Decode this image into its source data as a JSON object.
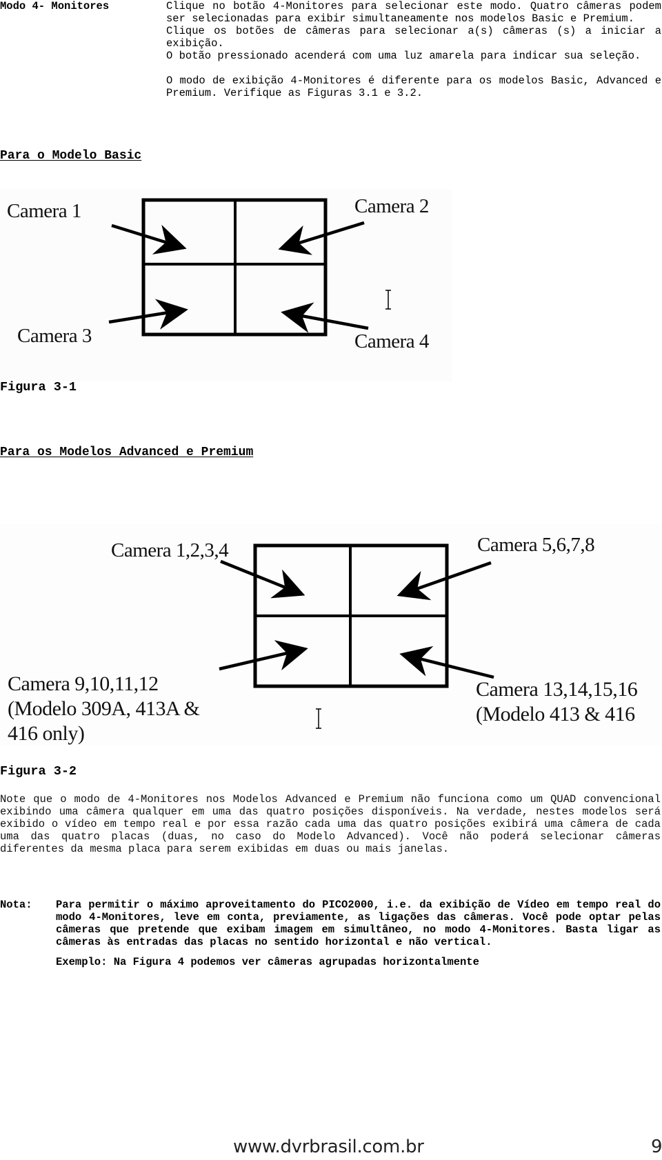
{
  "document": {
    "mode_title": "Modo 4- Monitores",
    "intro_paragraphs": [
      "Clique no botão 4-Monitores para selecionar este modo. Quatro câmeras podem ser selecionadas para exibir simultaneamente nos modelos Basic e Premium.",
      "Clique os botões de câmeras para selecionar a(s) câmeras (s) a iniciar a exibição.",
      "O botão pressionado acenderá com uma luz amarela para indicar sua seleção.",
      "O modo de exibição 4-Monitores é diferente para os modelos Basic, Advanced e Premium. Verifique as Figuras 3.1 e 3.2."
    ],
    "section_basic": {
      "heading": "Para o Modelo Basic",
      "figure_label": "Figura 3-1",
      "cameras": {
        "top_left": "Camera 1",
        "top_right": "Camera 2",
        "bottom_left": "Camera 3",
        "bottom_right": "Camera 4"
      }
    },
    "section_advanced": {
      "heading": "Para os Modelos Advanced e Premium",
      "figure_label": "Figura 3-2",
      "cameras": {
        "top_left": "Camera 1,2,3,4",
        "top_right": "Camera 5,6,7,8",
        "bottom_left_line1": "Camera 9,10,11,12",
        "bottom_left_line2": "(Modelo 309A, 413A &",
        "bottom_left_line3": "416 only)",
        "bottom_right_line1": "Camera 13,14,15,16",
        "bottom_right_line2": "(Modelo 413 & 416"
      }
    },
    "note_paragraph": "Note que o modo de 4-Monitores nos Modelos Advanced e Premium não funciona como um QUAD convencional exibindo uma câmera qualquer em uma das quatro posições disponíveis. Na verdade, nestes modelos será exibido o vídeo em tempo real e por essa razão cada uma das quatro posições exibirá uma câmera de cada uma das quatro placas (duas, no caso do Modelo Advanced). Você não poderá selecionar câmeras diferentes da mesma placa para serem exibidas em duas ou mais janelas.",
    "nota": {
      "label": "Nota:",
      "body": "Para permitir o máximo aproveitamento do PICO2000, i.e. da exibição de Vídeo em tempo real do modo 4-Monitores, leve em conta, previamente, as ligações das câmeras. Você pode optar pelas câmeras que pretende que exibam imagem em simultâneo, no modo 4-Monitores. Basta ligar as câmeras às entradas das placas no sentido horizontal e não vertical.",
      "example": "Exemplo: Na Figura 4 podemos ver câmeras agrupadas horizontalmente"
    },
    "footer": {
      "url": "www.dvrbrasil.com.br",
      "page_number": "9"
    }
  }
}
